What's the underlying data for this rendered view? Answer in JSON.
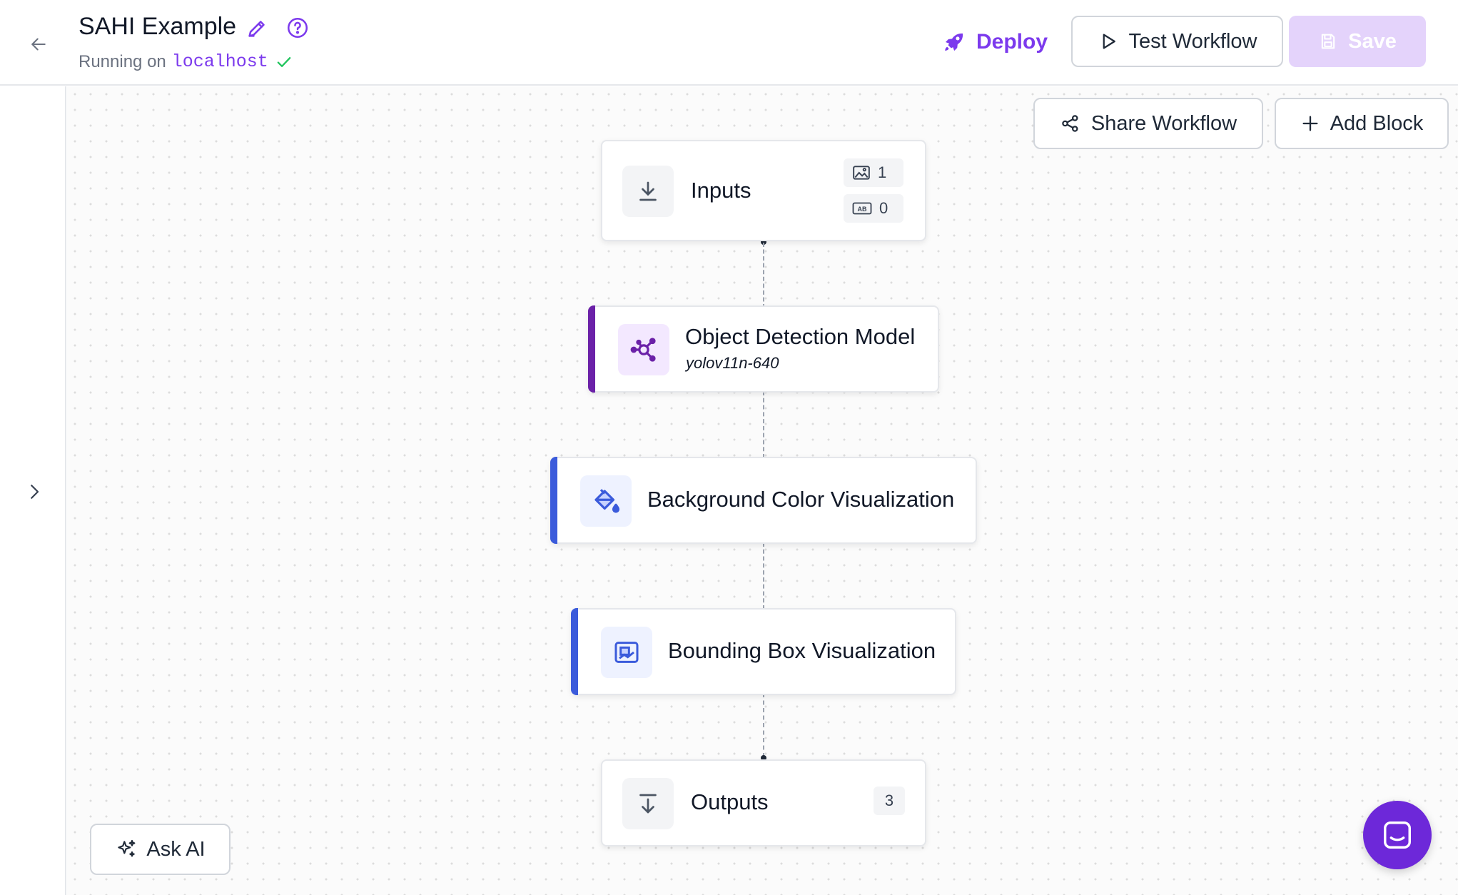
{
  "header": {
    "title": "SAHI Example",
    "status_prefix": "Running on",
    "status_host": "localhost",
    "deploy_label": "Deploy",
    "test_label": "Test Workflow",
    "save_label": "Save",
    "accent_color": "#7c3aed"
  },
  "canvas": {
    "share_label": "Share Workflow",
    "add_block_label": "Add Block",
    "ask_ai_label": "Ask AI"
  },
  "nodes": {
    "inputs": {
      "label": "Inputs",
      "image_count": "1",
      "param_count": "0",
      "icon": "download-icon"
    },
    "model": {
      "label": "Object Detection Model",
      "subtitle": "yolov11n-640",
      "icon": "model-graph-icon",
      "accent": "#6b21a8"
    },
    "bg_viz": {
      "label": "Background Color Visualization",
      "icon": "paint-bucket-icon",
      "accent": "#3b5bdb"
    },
    "bbox_viz": {
      "label": "Bounding Box Visualization",
      "icon": "bounding-box-icon",
      "accent": "#3b5bdb"
    },
    "outputs": {
      "label": "Outputs",
      "count": "3",
      "icon": "arrow-down-icon"
    }
  }
}
